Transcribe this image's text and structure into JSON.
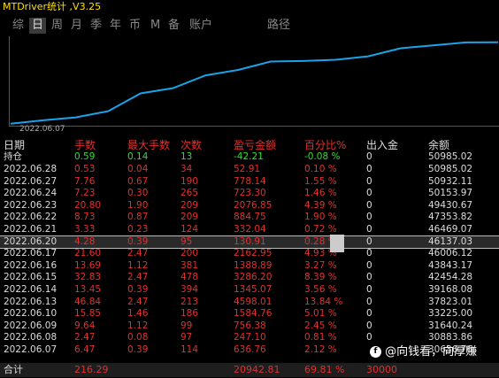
{
  "window": {
    "title": "MTDriver统计 ,V3.25"
  },
  "tabs": [
    {
      "label": "综"
    },
    {
      "label": "日",
      "active": true
    },
    {
      "label": "周"
    },
    {
      "label": "月"
    },
    {
      "label": "季"
    },
    {
      "label": "年"
    },
    {
      "label": "币"
    },
    {
      "label": "M"
    },
    {
      "label": "备"
    },
    {
      "label": "账户"
    },
    {
      "label": "路径"
    }
  ],
  "chart_data": {
    "type": "line",
    "x": [
      "2022.06.07",
      "2022.06.08",
      "2022.06.09",
      "2022.06.10",
      "2022.06.13",
      "2022.06.14",
      "2022.06.15",
      "2022.06.16",
      "2022.06.17",
      "2022.06.20",
      "2022.06.21",
      "2022.06.22",
      "2022.06.23",
      "2022.06.24",
      "2022.06.27",
      "2022.06.28"
    ],
    "series": [
      {
        "values": [
          30000,
          30883,
          31640,
          33225,
          37823,
          39168,
          42454,
          43843,
          46006,
          46137,
          46469,
          47353,
          49430,
          50153,
          50932,
          50985
        ]
      }
    ],
    "xlabel": "2022.06.07",
    "line_color": "#1aa3e8"
  },
  "table": {
    "headers": [
      "日期",
      "手数",
      "最大手数",
      "次数",
      "盈亏金额",
      "百分比%",
      "出入金",
      "余额"
    ],
    "holding": {
      "date": "持仓",
      "lots": "0.59",
      "max_lots": "0.14",
      "count": "13",
      "pnl": "-42.21",
      "pct": "-0.08 %",
      "io": "0",
      "balance": "50985.02"
    },
    "rows": [
      {
        "date": "2022.06.28",
        "lots": "0.53",
        "max_lots": "0.04",
        "count": "34",
        "pnl": "52.91",
        "pct": "0.10 %",
        "io": "0",
        "balance": "50985.02"
      },
      {
        "date": "2022.06.27",
        "lots": "7.76",
        "max_lots": "0.67",
        "count": "190",
        "pnl": "778.14",
        "pct": "1.55 %",
        "io": "0",
        "balance": "50932.11"
      },
      {
        "date": "2022.06.24",
        "lots": "7.23",
        "max_lots": "0.30",
        "count": "265",
        "pnl": "723.30",
        "pct": "1.46 %",
        "io": "0",
        "balance": "50153.97"
      },
      {
        "date": "2022.06.23",
        "lots": "20.80",
        "max_lots": "1.90",
        "count": "209",
        "pnl": "2076.85",
        "pct": "4.39 %",
        "io": "0",
        "balance": "49430.67"
      },
      {
        "date": "2022.06.22",
        "lots": "8.73",
        "max_lots": "0.87",
        "count": "209",
        "pnl": "884.75",
        "pct": "1.90 %",
        "io": "0",
        "balance": "47353.82"
      },
      {
        "date": "2022.06.21",
        "lots": "3.33",
        "max_lots": "0.23",
        "count": "124",
        "pnl": "332.04",
        "pct": "0.72 %",
        "io": "0",
        "balance": "46469.07"
      },
      {
        "date": "2022.06.20",
        "lots": "4.28",
        "max_lots": "0.39",
        "count": "95",
        "pnl": "130.91",
        "pct": "0.28 %",
        "io": "0",
        "balance": "46137.03",
        "selected": true
      },
      {
        "date": "2022.06.17",
        "lots": "21.60",
        "max_lots": "2.47",
        "count": "200",
        "pnl": "2162.95",
        "pct": "4.93 %",
        "io": "0",
        "balance": "46006.12"
      },
      {
        "date": "2022.06.16",
        "lots": "13.69",
        "max_lots": "1.12",
        "count": "381",
        "pnl": "1388.89",
        "pct": "3.27 %",
        "io": "0",
        "balance": "43843.17"
      },
      {
        "date": "2022.06.15",
        "lots": "32.83",
        "max_lots": "2.47",
        "count": "478",
        "pnl": "3286.20",
        "pct": "8.39 %",
        "io": "0",
        "balance": "42454.28"
      },
      {
        "date": "2022.06.14",
        "lots": "13.45",
        "max_lots": "0.39",
        "count": "394",
        "pnl": "1345.07",
        "pct": "3.56 %",
        "io": "0",
        "balance": "39168.08"
      },
      {
        "date": "2022.06.13",
        "lots": "46.84",
        "max_lots": "2.47",
        "count": "213",
        "pnl": "4598.01",
        "pct": "13.84 %",
        "io": "0",
        "balance": "37823.01"
      },
      {
        "date": "2022.06.10",
        "lots": "15.85",
        "max_lots": "1.46",
        "count": "186",
        "pnl": "1584.76",
        "pct": "5.01 %",
        "io": "0",
        "balance": "33225.00"
      },
      {
        "date": "2022.06.09",
        "lots": "9.64",
        "max_lots": "1.12",
        "count": "99",
        "pnl": "756.38",
        "pct": "2.45 %",
        "io": "0",
        "balance": "31640.24"
      },
      {
        "date": "2022.06.08",
        "lots": "2.47",
        "max_lots": "0.08",
        "count": "97",
        "pnl": "247.10",
        "pct": "0.81 %",
        "io": "0",
        "balance": "30883.86"
      },
      {
        "date": "2022.06.07",
        "lots": "6.47",
        "max_lots": "0.39",
        "count": "114",
        "pnl": "636.76",
        "pct": "2.12 %",
        "io": "",
        "balance": "30636.76"
      }
    ],
    "total": {
      "label": "合计",
      "lots": "216.29",
      "pnl": "20942.81",
      "pct": "69.81 %",
      "io": "30000"
    }
  },
  "watermark": {
    "icon": "f",
    "text": "@向钱看，向厚赚"
  },
  "colors": {
    "title": "#ffe000",
    "positive": "#e03030",
    "negative": "#28e028",
    "line": "#1aa3e8"
  }
}
